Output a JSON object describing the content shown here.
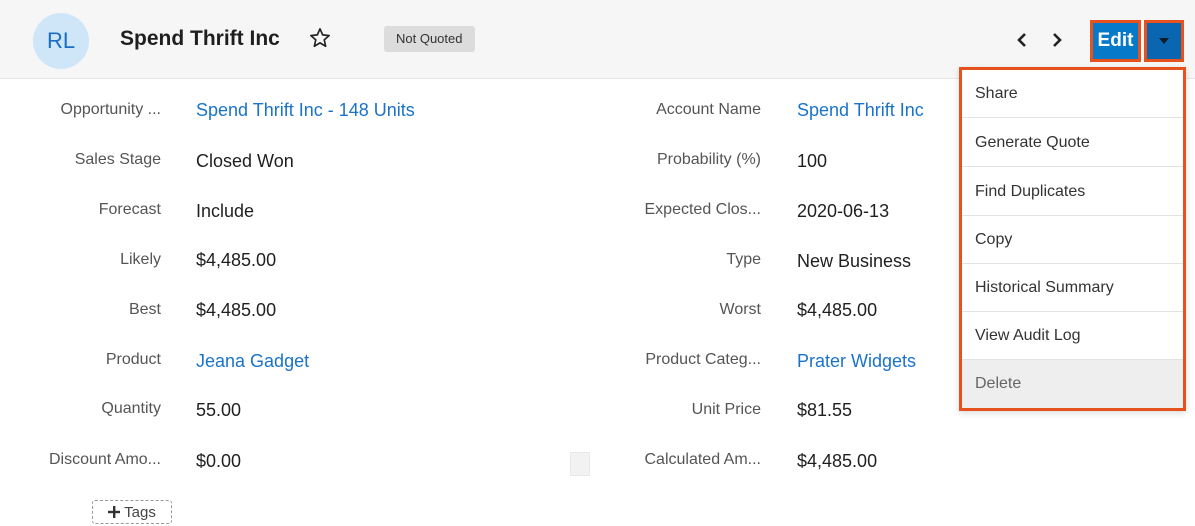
{
  "header": {
    "avatar_initials": "RL",
    "title": "Spend Thrift Inc",
    "status_badge": "Not Quoted",
    "edit_label": "Edit",
    "accent_color": "#0679c8",
    "highlight_color": "#e5521e"
  },
  "fields_left": [
    {
      "label": "Opportunity ...",
      "value": "Spend Thrift Inc - 148 Units",
      "link": true
    },
    {
      "label": "Sales Stage",
      "value": "Closed Won",
      "link": false
    },
    {
      "label": "Forecast",
      "value": "Include",
      "link": false
    },
    {
      "label": "Likely",
      "value": "$4,485.00",
      "link": false
    },
    {
      "label": "Best",
      "value": "$4,485.00",
      "link": false
    },
    {
      "label": "Product",
      "value": "Jeana Gadget",
      "link": true
    },
    {
      "label": "Quantity",
      "value": "55.00",
      "link": false
    },
    {
      "label": "Discount Amo...",
      "value": "$0.00",
      "link": false
    }
  ],
  "fields_right": [
    {
      "label": "Account Name",
      "value": "Spend Thrift Inc",
      "link": true
    },
    {
      "label": "Probability (%)",
      "value": "100",
      "link": false
    },
    {
      "label": "Expected Clos...",
      "value": "2020-06-13",
      "link": false
    },
    {
      "label": "Type",
      "value": "New Business",
      "link": false
    },
    {
      "label": "Worst",
      "value": "$4,485.00",
      "link": false
    },
    {
      "label": "Product Categ...",
      "value": "Prater Widgets",
      "link": true
    },
    {
      "label": "Unit Price",
      "value": "$81.55",
      "link": false
    },
    {
      "label": "Calculated Am...",
      "value": "$4,485.00",
      "link": false
    }
  ],
  "tags_label": "Tags",
  "dropdown_items": [
    {
      "label": "Share"
    },
    {
      "label": "Generate Quote"
    },
    {
      "label": "Find Duplicates"
    },
    {
      "label": "Copy"
    },
    {
      "label": "Historical Summary"
    },
    {
      "label": "View Audit Log"
    },
    {
      "label": "Delete"
    }
  ],
  "icons": {
    "favorite": "star-outline-icon",
    "prev": "chevron-left-icon",
    "next": "chevron-right-icon",
    "menu": "caret-down-icon",
    "add": "plus-icon"
  }
}
